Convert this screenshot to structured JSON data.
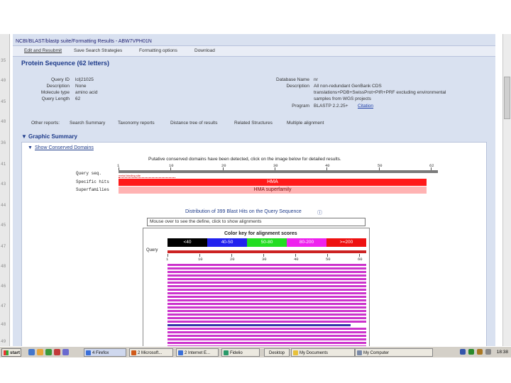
{
  "window": {
    "title": "NCBI/BLAST/blastp suite/Formatting Results - ABW7VPH01N"
  },
  "gutter_numbers": [
    "35",
    "40",
    "45",
    "48",
    "36",
    "41",
    "43",
    "44",
    "45",
    "47",
    "48",
    "46",
    "47",
    "48",
    "49"
  ],
  "toolbar": {
    "edit_resubmit": "Edit and Resubmit",
    "save_search": "Save Search Strategies",
    "formatting_options": "Formatting options",
    "download": "Download"
  },
  "protein": {
    "heading": "Protein Sequence (62 letters)",
    "query_id_label": "Query ID",
    "query_id": "lcl|21025",
    "description_label": "Description",
    "description": "None",
    "molecule_label": "Molecule type",
    "molecule": "amino acid",
    "query_length_label": "Query Length",
    "query_length": "62",
    "database_name_label": "Database Name",
    "database_name": "nr",
    "db_description_label": "Description",
    "db_description_lines": [
      "All non-redundant GenBank CDS",
      "translations+PDB+SwissProt+PIR+PRF excluding environmental",
      "samples from WGS projects"
    ],
    "program_label": "Program",
    "program": "BLASTP 2.2.25+",
    "citation": "Citation"
  },
  "other_reports": {
    "label": "Other reports:",
    "items": [
      "Search Summary",
      "Taxonomy reports",
      "Distance tree of results",
      "Related Structures",
      "Multiple alignment"
    ]
  },
  "graphic_summary": {
    "heading": "Graphic Summary",
    "show_cdd": "Show Conserved Domains",
    "cdd_notice": "Putative conserved domains have been detected, click on the image below for detailed results.",
    "query_seq_label": "Query seq.",
    "specific_label": "Specific hits",
    "superfam_label": "Superfamilies",
    "ruler_marks": [
      "1",
      "10",
      "20",
      "30",
      "40",
      "50",
      "62"
    ],
    "specific_hit": "HMA",
    "superfamily_hit": "HMA superfamily",
    "binding_note": "metal binding site",
    "distribution": "Distribution of 399 Blast Hits on the Query Sequence",
    "mouse_hint": "Mouse over to see the define, click to show alignments",
    "color_key_title": "Color key for alignment scores",
    "color_keys": [
      {
        "label": "<40",
        "color": "#000000"
      },
      {
        "label": "40-50",
        "color": "#2222ee"
      },
      {
        "label": "50-80",
        "color": "#22dd22"
      },
      {
        "label": "80-200",
        "color": "#ee22ee"
      },
      {
        "label": ">=200",
        "color": "#ee1111"
      }
    ],
    "query_label": "Query",
    "axis_ticks": [
      "1",
      "10",
      "20",
      "30",
      "40",
      "50",
      "60"
    ],
    "hit_color": "#cc33cc",
    "hit_alt_color": "#3333aa"
  },
  "taskbar": {
    "start": "start",
    "buttons": [
      "4 Firefox",
      "2 Microsoft...",
      "2 Internet E...",
      "Fidelio",
      "Desktop",
      "My Documents",
      "My Computer"
    ],
    "clock": "18:38"
  }
}
